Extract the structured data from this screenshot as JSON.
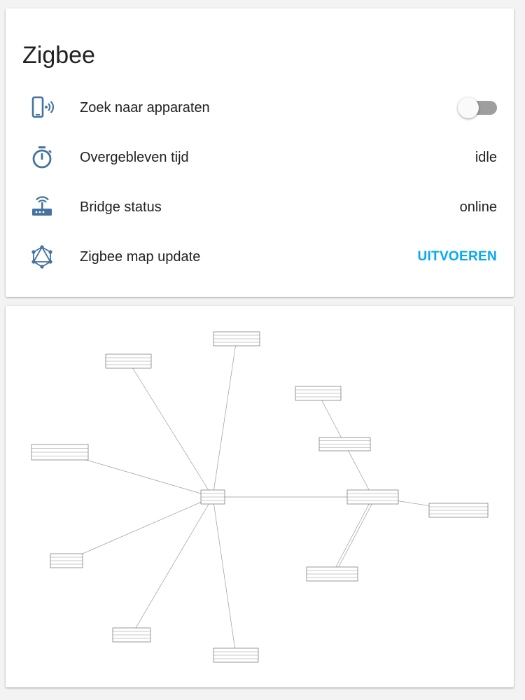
{
  "header": {
    "title": "Zigbee"
  },
  "rows": [
    {
      "label": "Zoek naar apparaten",
      "icon": "cellphone-wireless-icon",
      "toggle_on": false
    },
    {
      "label": "Overgebleven tijd",
      "icon": "timer-icon",
      "value": "idle"
    },
    {
      "label": "Bridge status",
      "icon": "router-wireless-icon",
      "value": "online"
    },
    {
      "label": "Zigbee map update",
      "icon": "graphql-icon",
      "action": "UITVOEREN"
    }
  ],
  "colors": {
    "icon": "#44739e",
    "accent": "#03a9f4",
    "toggle_track": "#9e9e9e"
  },
  "map": {
    "nodes": [
      {
        "id": "coordinator"
      },
      {
        "id": "router-a"
      },
      {
        "id": "router-b"
      },
      {
        "id": "end-top-center"
      },
      {
        "id": "end-top-left"
      },
      {
        "id": "end-left"
      },
      {
        "id": "end-lower-left"
      },
      {
        "id": "end-bottom-left"
      },
      {
        "id": "end-bottom-center"
      },
      {
        "id": "end-right-top"
      },
      {
        "id": "end-right"
      },
      {
        "id": "end-right-bottom"
      }
    ]
  }
}
